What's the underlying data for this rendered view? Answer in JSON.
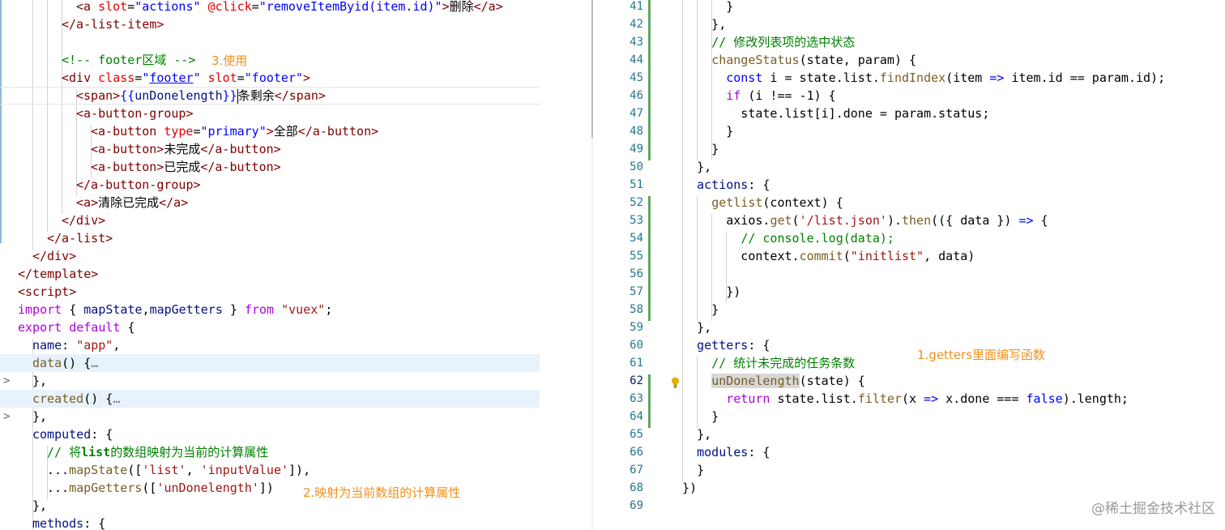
{
  "left_code": [
    "      <a slot=\"actions\" @click=\"removeItemByid(item.id)\">删除</a>",
    "    </a-list-item>",
    "",
    "    <!-- footer区域 -->",
    "    <div class=\"footer\" slot=\"footer\">",
    "      <span>{{unDonelength}}条剩余</span>",
    "      <a-button-group>",
    "        <a-button type=\"primary\">全部</a-button>",
    "        <a-button>未完成</a-button>",
    "        <a-button>已完成</a-button>",
    "      </a-button-group>",
    "      <a>清除已完成</a>",
    "    </div>",
    "  </a-list>",
    "  </div>",
    "</template>",
    "<script>",
    "import { mapState,mapGetters } from \"vuex\";",
    "export default {",
    "  name: \"app\",",
    "  data() {…",
    "  },",
    "  created() {…",
    "  },",
    "  computed: {",
    "    // 将list的数组映射为当前的计算属性",
    "    ...mapState(['list', 'inputValue']),",
    "    ...mapGetters(['unDonelength'])",
    "  },",
    "  methods: {"
  ],
  "right_line_numbers": [
    "41",
    "42",
    "43",
    "44",
    "45",
    "46",
    "47",
    "48",
    "49",
    "50",
    "51",
    "52",
    "53",
    "54",
    "55",
    "56",
    "57",
    "58",
    "59",
    "60",
    "61",
    "62",
    "63",
    "64",
    "65",
    "66",
    "67",
    "68",
    "69"
  ],
  "right_code": [
    "        }",
    "      },",
    "      // 修改列表项的选中状态",
    "      changeStatus(state, param) {",
    "        const i = state.list.findIndex(item => item.id == param.id);",
    "        if (i !== -1) {",
    "          state.list[i].done = param.status;",
    "        }",
    "      }",
    "    },",
    "    actions: {",
    "      getlist(context) {",
    "        axios.get('/list.json').then(({ data }) => {",
    "          // console.log(data);",
    "          context.commit(\"initlist\", data)",
    "",
    "        })",
    "      }",
    "    },",
    "    getters: {",
    "      // 统计未完成的任务条数",
    "      unDonelength(state) {",
    "        return state.list.filter(x => x.done === false).length;",
    "      }",
    "    },",
    "    modules: {",
    "    }",
    "  })",
    ""
  ],
  "annotations": {
    "use": "3.使用",
    "getters": "1.getters里面编写函数",
    "map": "2.映射为当前数组的计算属性"
  },
  "watermark": "@稀土掘金技术社区",
  "fold_marker": ">",
  "icons": {
    "lightbulb": "lightbulb-icon"
  },
  "colors": {
    "annotation": "#f0901c",
    "line_number": "#237893",
    "folded_highlight": "#e8f2fb",
    "modified_bar": "#5fa65f"
  }
}
